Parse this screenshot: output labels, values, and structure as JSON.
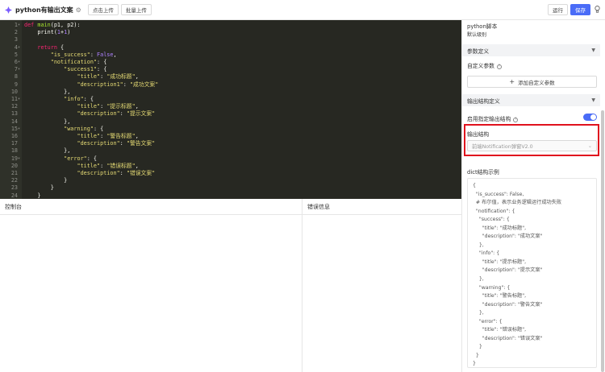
{
  "header": {
    "title": "python有输出文案",
    "upload_click": "点击上传",
    "upload_batch": "批量上传",
    "run": "运行",
    "save": "保存"
  },
  "editor": {
    "lines": [
      {
        "n": "1",
        "fold": true,
        "tokens": [
          [
            "kw",
            "def "
          ],
          [
            "fn",
            "main"
          ],
          [
            "",
            "(p1, p2):"
          ]
        ]
      },
      {
        "n": "2",
        "fold": false,
        "tokens": [
          [
            "",
            "    print("
          ],
          [
            "num",
            "1"
          ],
          [
            "",
            "+"
          ],
          [
            "num",
            "1"
          ],
          [
            "",
            ")"
          ]
        ]
      },
      {
        "n": "3",
        "fold": false,
        "tokens": [
          [
            "",
            ""
          ]
        ]
      },
      {
        "n": "4",
        "fold": true,
        "tokens": [
          [
            "kw",
            "    return"
          ],
          [
            "",
            " {"
          ]
        ]
      },
      {
        "n": "5",
        "fold": false,
        "tokens": [
          [
            "str",
            "        \"is_success\""
          ],
          [
            "",
            ": "
          ],
          [
            "bool",
            "False"
          ],
          [
            "",
            ","
          ]
        ]
      },
      {
        "n": "6",
        "fold": true,
        "tokens": [
          [
            "str",
            "        \"notification\""
          ],
          [
            "",
            ": {"
          ]
        ]
      },
      {
        "n": "7",
        "fold": true,
        "tokens": [
          [
            "str",
            "            \"success1\""
          ],
          [
            "",
            ": {"
          ]
        ]
      },
      {
        "n": "8",
        "fold": false,
        "tokens": [
          [
            "str",
            "                \"title\""
          ],
          [
            "",
            ": "
          ],
          [
            "str",
            "\"成功标题\""
          ],
          [
            "",
            ","
          ]
        ]
      },
      {
        "n": "9",
        "fold": false,
        "tokens": [
          [
            "str",
            "                \"description1\""
          ],
          [
            "",
            ": "
          ],
          [
            "str",
            "\"成功文案\""
          ]
        ]
      },
      {
        "n": "10",
        "fold": false,
        "tokens": [
          [
            "",
            "            },"
          ]
        ]
      },
      {
        "n": "11",
        "fold": true,
        "tokens": [
          [
            "str",
            "            \"info\""
          ],
          [
            "",
            ": {"
          ]
        ]
      },
      {
        "n": "12",
        "fold": false,
        "tokens": [
          [
            "str",
            "                \"title\""
          ],
          [
            "",
            ": "
          ],
          [
            "str",
            "\"提示标题\""
          ],
          [
            "",
            ","
          ]
        ]
      },
      {
        "n": "13",
        "fold": false,
        "tokens": [
          [
            "str",
            "                \"description\""
          ],
          [
            "",
            ": "
          ],
          [
            "str",
            "\"提示文案\""
          ]
        ]
      },
      {
        "n": "14",
        "fold": false,
        "tokens": [
          [
            "",
            "            },"
          ]
        ]
      },
      {
        "n": "15",
        "fold": true,
        "tokens": [
          [
            "str",
            "            \"warning\""
          ],
          [
            "",
            ": {"
          ]
        ]
      },
      {
        "n": "16",
        "fold": false,
        "tokens": [
          [
            "str",
            "                \"title\""
          ],
          [
            "",
            ": "
          ],
          [
            "str",
            "\"警告标题\""
          ],
          [
            "",
            ","
          ]
        ]
      },
      {
        "n": "17",
        "fold": false,
        "tokens": [
          [
            "str",
            "                \"description\""
          ],
          [
            "",
            ": "
          ],
          [
            "str",
            "\"警告文案\""
          ]
        ]
      },
      {
        "n": "18",
        "fold": false,
        "tokens": [
          [
            "",
            "            },"
          ]
        ]
      },
      {
        "n": "19",
        "fold": true,
        "tokens": [
          [
            "str",
            "            \"error\""
          ],
          [
            "",
            ": {"
          ]
        ]
      },
      {
        "n": "20",
        "fold": false,
        "tokens": [
          [
            "str",
            "                \"title\""
          ],
          [
            "",
            ": "
          ],
          [
            "str",
            "\"错误标题\""
          ],
          [
            "",
            ","
          ]
        ]
      },
      {
        "n": "21",
        "fold": false,
        "tokens": [
          [
            "str",
            "                \"description\""
          ],
          [
            "",
            ": "
          ],
          [
            "str",
            "\"错误文案\""
          ]
        ]
      },
      {
        "n": "22",
        "fold": false,
        "tokens": [
          [
            "",
            "            }"
          ]
        ]
      },
      {
        "n": "23",
        "fold": false,
        "tokens": [
          [
            "",
            "        }"
          ]
        ]
      },
      {
        "n": "24",
        "fold": false,
        "tokens": [
          [
            "",
            "    }"
          ]
        ]
      }
    ]
  },
  "console": {
    "title": "控制台"
  },
  "error_panel": {
    "title": "错误信息"
  },
  "right_panel": {
    "title": "python脚本",
    "subtitle": "默认级别",
    "params_section": "参数定义",
    "custom_params_label": "自定义参数",
    "add_param": "添加自定义参数",
    "output_section": "输出结构定义",
    "enable_output_label": "启用指定输出结构",
    "output_struct_label": "输出结构",
    "output_struct_value": "前端Notification弹窗V2.0",
    "dict_example_label": "dict结构示例",
    "dict_example_lines": [
      "{",
      "  \"is_success\": False,",
      "  # 布尔值，表示业务逻辑运行成功失败",
      "  \"notification\": {",
      "    \"success\": {",
      "      \"title\": \"成功标题\",",
      "      \"description\": \"成功文案\"",
      "    },",
      "    \"info\": {",
      "      \"title\": \"提示标题\",",
      "      \"description\": \"提示文案\"",
      "    },",
      "    \"warning\": {",
      "      \"title\": \"警告标题\",",
      "      \"description\": \"警告文案\"",
      "    },",
      "    \"error\": {",
      "      \"title\": \"错误标题\",",
      "      \"description\": \"错误文案\"",
      "    }",
      "  }",
      "}"
    ]
  }
}
